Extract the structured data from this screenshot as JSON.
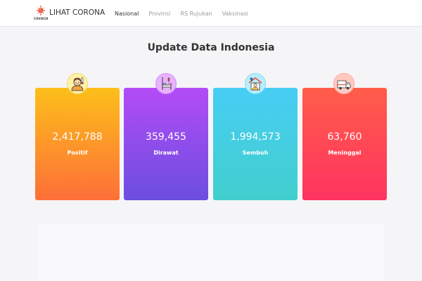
{
  "navbar": {
    "brand_name": "LIHAT CORONA",
    "brand_sub": "COVID19",
    "links": [
      "Nasional",
      "Provinsi",
      "RS Rujukan",
      "Vaksinasi"
    ],
    "active": "Nasional"
  },
  "page_title": "Update Data Indonesia",
  "cards": [
    {
      "value": "2,417,788",
      "label": "Positif",
      "icon": "sick-person-icon"
    },
    {
      "value": "359,455",
      "label": "Dirawat",
      "icon": "hospital-bed-icon"
    },
    {
      "value": "1,994,573",
      "label": "Sembuh",
      "icon": "home-recovery-icon"
    },
    {
      "value": "63,760",
      "label": "Meninggal",
      "icon": "hearse-icon"
    }
  ],
  "colors": {
    "positif": "#fd8a2c",
    "dirawat": "#9a4ef0",
    "sembuh": "#45cee0",
    "meninggal": "#ff4556"
  }
}
